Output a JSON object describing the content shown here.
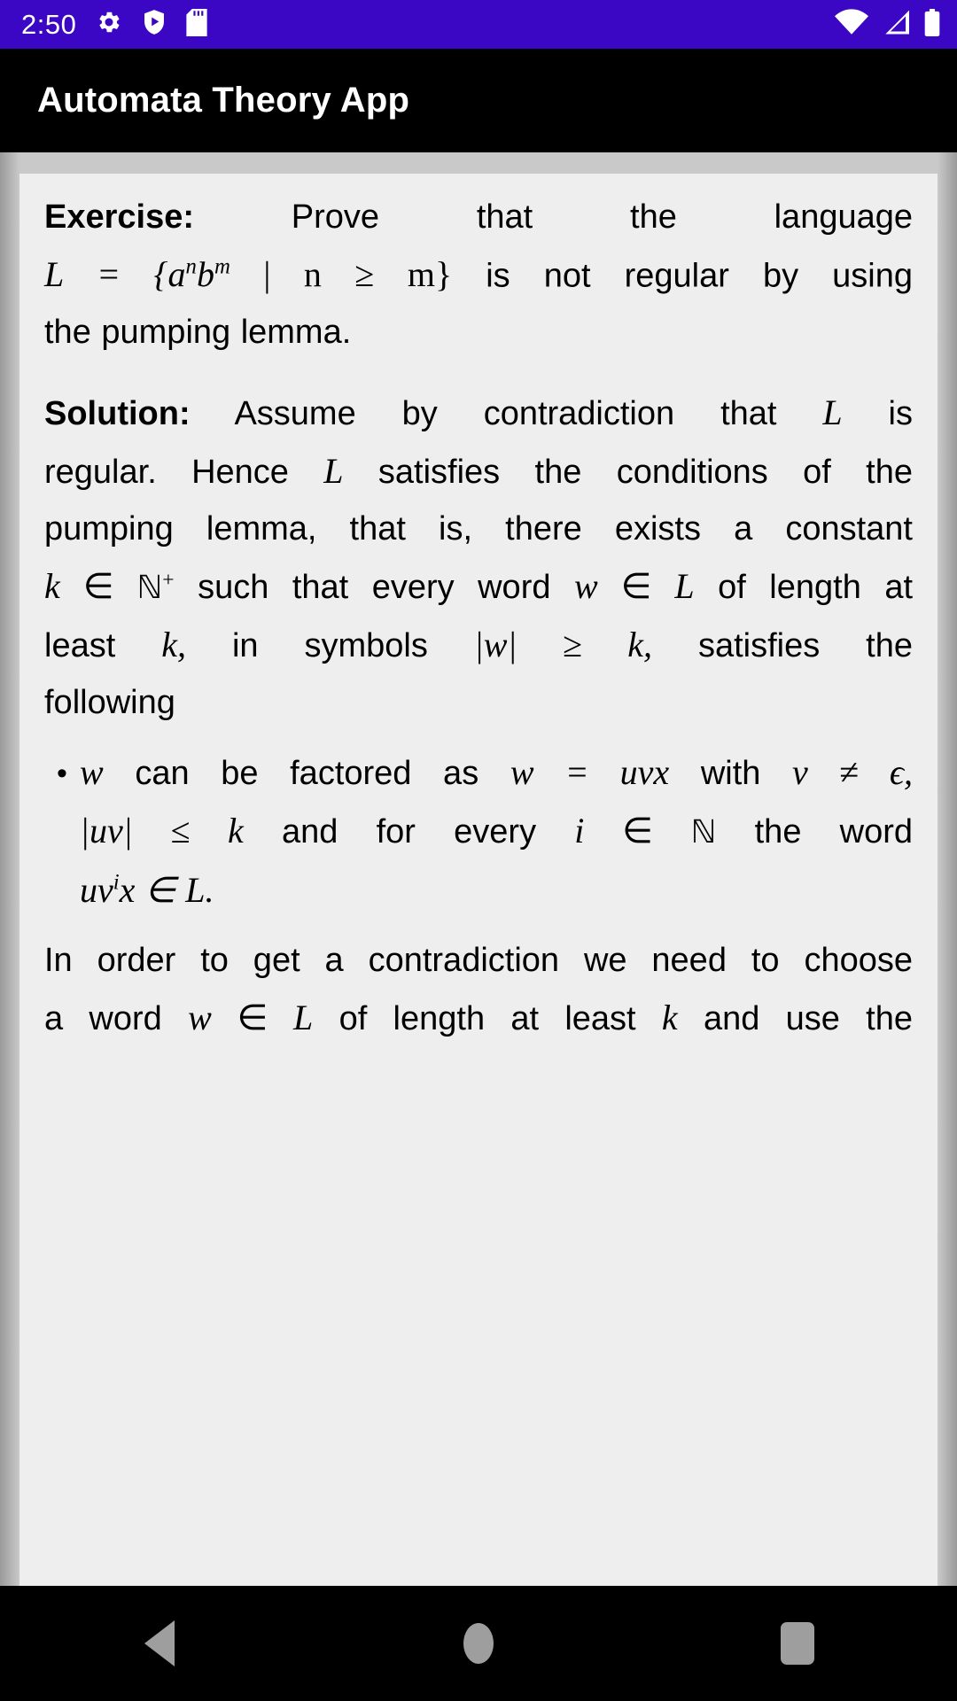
{
  "statusbar": {
    "time": "2:50",
    "icons_left": [
      "gear-icon",
      "shield-play-icon",
      "sd-card-icon"
    ],
    "icons_right": [
      "wifi-icon",
      "cellular-signal-icon",
      "battery-icon"
    ],
    "background_color": "#3b06c4",
    "foreground_color": "#ffffff"
  },
  "appbar": {
    "title": "Automata Theory App",
    "background_color": "#000000",
    "text_color": "#ffffff"
  },
  "document": {
    "card_background": "#eeeeee",
    "page_background": "#c9c9c9",
    "exercise": {
      "label": "Exercise:",
      "line1_text": "Prove that the language",
      "formula_L": "L = {a",
      "formula_sup_n": "n",
      "formula_b": "b",
      "formula_sup_m": "m",
      "formula_mid": " | n ≥ m}",
      "line2_text": "is not regular by using",
      "line3_text": "the pumping lemma."
    },
    "solution": {
      "label": "Solution:",
      "seg1": "Assume by contradiction that",
      "var_L1": "L",
      "seg2": "is",
      "seg3": "regular. Hence",
      "var_L2": "L",
      "seg4": "satisfies the conditions of the",
      "seg5": "pumping lemma, that is, there exists a constant",
      "var_k": "k",
      "elem1": " ∈ ",
      "set_N": "ℕ",
      "sup_plus": "+",
      "seg6": "such that every word",
      "var_w": "w",
      "elem2": " ∈ ",
      "var_L3": "L",
      "seg7": "of length at",
      "seg8": "least",
      "var_k2": "k,",
      "seg9": "in symbols",
      "abs_w": "|w| ≥ k,",
      "seg10": "satisfies the",
      "seg11": "following"
    },
    "bullet": {
      "marker": "•",
      "b_var_w": "w",
      "b_seg1": "can be factored as",
      "b_eq": "w = uvx",
      "b_seg2": "with",
      "b_neq": "v ≠ ϵ,",
      "b_abs_uv": "|uv| ≤ k",
      "b_seg3": "and for every",
      "b_var_i": "i",
      "b_elem": " ∈ ",
      "b_set_N": "ℕ",
      "b_seg4": "the word",
      "b_word": "uv",
      "b_sup_i": "i",
      "b_word2": "x ∈ L."
    },
    "closing": {
      "line1": "In order to get a contradiction we need to choose",
      "seg1": "a word",
      "var_w": "w",
      "elem": " ∈ ",
      "var_L": "L",
      "seg2": "of length at least",
      "var_k": "k",
      "seg3": "and use the"
    }
  },
  "navbar": {
    "background_color": "#000000",
    "icon_color": "#9e9e9e",
    "buttons": [
      {
        "name": "back-button",
        "icon": "triangle-left-icon"
      },
      {
        "name": "home-button",
        "icon": "circle-icon"
      },
      {
        "name": "recents-button",
        "icon": "square-icon"
      }
    ]
  }
}
